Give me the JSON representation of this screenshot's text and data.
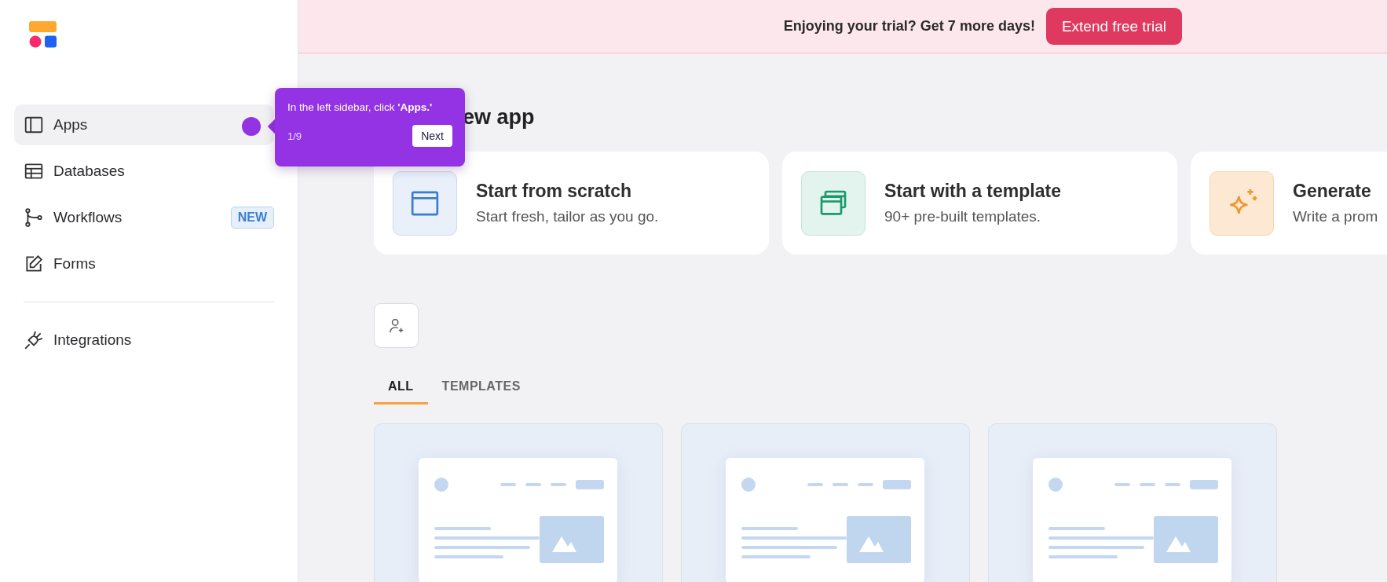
{
  "sidebar": {
    "items": [
      {
        "kind": "apps",
        "label": "Apps",
        "selected": true
      },
      {
        "kind": "databases",
        "label": "Databases",
        "selected": false
      },
      {
        "kind": "workflows",
        "label": "Workflows",
        "selected": false,
        "badge": "NEW"
      },
      {
        "kind": "forms",
        "label": "Forms",
        "selected": false
      },
      {
        "kind": "divider"
      },
      {
        "kind": "integrations",
        "label": "Integrations",
        "selected": false
      }
    ]
  },
  "banner": {
    "text": "Enjoying your trial? Get 7 more days!",
    "button": "Extend free trial"
  },
  "heading": "ew app",
  "start_cards": [
    {
      "kind": "scratch",
      "title": "Start from scratch",
      "subtitle": "Start fresh, tailor as you go."
    },
    {
      "kind": "template",
      "title": "Start with a template",
      "subtitle": "90+ pre-built templates."
    },
    {
      "kind": "generate",
      "title": "Generate",
      "subtitle": "Write a prom"
    }
  ],
  "tabs": [
    {
      "label": "ALL",
      "selected": true
    },
    {
      "label": "TEMPLATES",
      "selected": false
    }
  ],
  "template_cards": [
    {
      "kind": "preview"
    },
    {
      "kind": "preview"
    },
    {
      "kind": "preview"
    }
  ],
  "tour": {
    "text": "In the left sidebar, click **'Apps.'**",
    "step": "1/9",
    "button": "Next"
  }
}
